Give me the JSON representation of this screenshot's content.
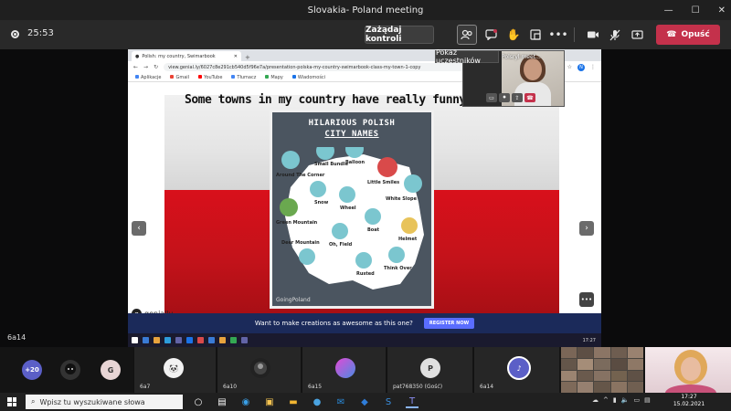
{
  "window": {
    "title": "Slovakia- Poland meeting"
  },
  "toolbar": {
    "timer": "25:53",
    "request_control_label": "Zażądaj kontroli",
    "show_participants_tooltip": "Pokaż uczestników",
    "leave_label": "Opuść",
    "leave_color": "#c4314b"
  },
  "browser": {
    "tab_title": "Polish: my country, Swimarbook",
    "url": "view.genial.ly/6027c8e291cb540d5f96e7a/presentation-polska-my-country-swimarbook-class-my-town-1-copy",
    "bookmarks": [
      "Aplikacje",
      "Gmail",
      "YouTube",
      "Tłumacz",
      "Mapy",
      "Wiadomości"
    ],
    "avatar_letter": "N"
  },
  "slide": {
    "heading": "Some towns in my country have really funny n",
    "poster_title_line1": "HILARIOUS POLISH",
    "poster_title_line2": "CITY NAMES",
    "map_labels": [
      "Around The Corner",
      "Small Bundle",
      "Balloon",
      "Little Smiles",
      "Snow",
      "Wheel",
      "White Slope",
      "Green Mountain",
      "Boat",
      "Deer Mountain",
      "Oh, Field",
      "Helmet",
      "Rusted",
      "Think Over"
    ],
    "poster_credit": "GoingPoland",
    "logo_text": "genially",
    "flag_white": "#e8e8e8",
    "flag_red": "#c4121a"
  },
  "promo": {
    "text": "Want to make creations as awesome as this one?",
    "button": "REGISTER NOW"
  },
  "inner_clock": "17:27",
  "pip": {
    "name": "Polsryl meet..."
  },
  "stage_label": "6a14",
  "strip": {
    "overflow_count": "+20",
    "avatar_g_letter": "G",
    "avatar_p_letter": "P",
    "tiles": [
      {
        "label": "6a7"
      },
      {
        "label": "6a10"
      },
      {
        "label": "6a15"
      },
      {
        "label": "pat768350 (Gość)"
      },
      {
        "label": "6a14"
      }
    ]
  },
  "taskbar": {
    "search_placeholder": "Wpisz tu wyszukiwane słowa",
    "time": "17:27",
    "date": "15.02.2021"
  }
}
